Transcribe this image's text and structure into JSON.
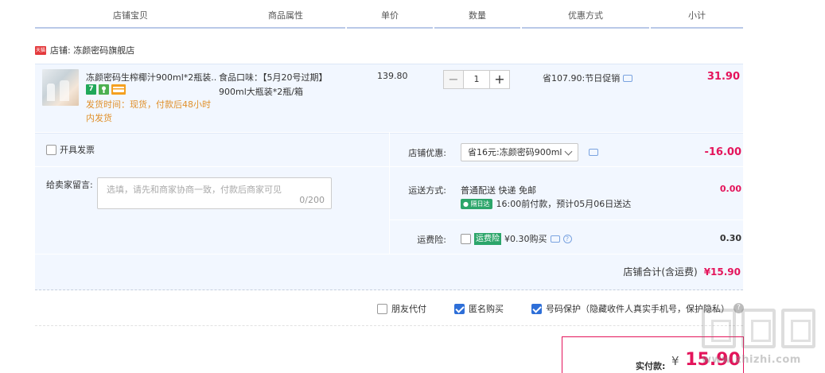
{
  "header": {
    "cols": [
      "店铺宝贝",
      "商品属性",
      "单价",
      "数量",
      "优惠方式",
      "小计"
    ]
  },
  "shop": {
    "icon_label": "天猫",
    "name": "店铺: 冻颜密码旗舰店"
  },
  "item": {
    "title": "冻颜密码生榨椰汁900ml*2瓶装...",
    "badges": [
      "7",
      "",
      ""
    ],
    "ship_time": "发货时间：现货，付款后48小时内发货",
    "attributes": "食品口味：【5月20号过期】900ml大瓶装*2瓶/箱",
    "price": "139.80",
    "quantity": "1",
    "minus": "−",
    "plus": "+",
    "promotion": "省107.90:节日促销",
    "subtotal": "31.90"
  },
  "invoice": {
    "label": "开具发票",
    "checked": false
  },
  "message": {
    "label": "给卖家留言:",
    "placeholder": "选填，请先和商家协商一致，付款后商家可见",
    "count": "0/200"
  },
  "shop_discount": {
    "label": "店铺优惠:",
    "selected": "省16元:冻颜密码900ml",
    "amount": "-16.00"
  },
  "shipping": {
    "label": "运送方式:",
    "method": "普通配送 快递 免邮",
    "tag": "隔日达",
    "estimate": "16:00前付款，预计05月06日送达",
    "amount": "0.00"
  },
  "insurance": {
    "label": "运费险:",
    "tag": "运费险",
    "price": "¥0.30购买",
    "amount": "0.30"
  },
  "shop_total": {
    "label": "店铺合计(含运费)",
    "value": "¥15.90"
  },
  "extras": {
    "friend_pay": "朋友代付",
    "anonymous": "匿名购买",
    "number_protect": "号码保护（隐藏收件人真实手机号，保护隐私）",
    "help": "?"
  },
  "payment": {
    "label": "实付款:",
    "currency": "¥",
    "value": "15.90"
  },
  "watermark": {
    "text": "www.zhizhi.com"
  },
  "colors": {
    "accent": "#e4145b",
    "panel_bg": "#f2f7ff",
    "check_blue": "#2e6fd8",
    "green_tag": "#2ba56a"
  }
}
